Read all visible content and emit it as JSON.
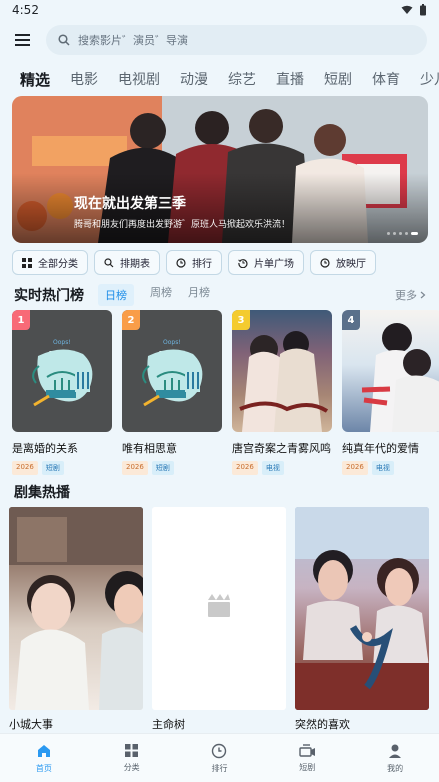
{
  "status": {
    "time": "4:52"
  },
  "search": {
    "placeholder": "搜索影片゛演员゛导演"
  },
  "tabs": [
    "精选",
    "电影",
    "电视剧",
    "动漫",
    "综艺",
    "直播",
    "短剧",
    "体育",
    "少儿"
  ],
  "banner": {
    "title": "现在就出发第三季",
    "subtitle": "腾哥和朋友们再度出发野游゛原班人马掀起欢乐洪流！"
  },
  "quick_actions": [
    {
      "label": "全部分类",
      "icon": "grid-icon"
    },
    {
      "label": "排期表",
      "icon": "search-icon"
    },
    {
      "label": "排行",
      "icon": "clock-icon"
    },
    {
      "label": "片单广场",
      "icon": "history-icon"
    },
    {
      "label": "放映厅",
      "icon": "clock-icon"
    }
  ],
  "rankings": {
    "title": "实时热门榜",
    "tabs": [
      "日榜",
      "周榜",
      "月榜"
    ],
    "more": "更多",
    "items": [
      {
        "rank": "1",
        "title": "是离婚的关系",
        "year": "2026",
        "kind": "短剧"
      },
      {
        "rank": "2",
        "title": "唯有相思意",
        "year": "2026",
        "kind": "短剧"
      },
      {
        "rank": "3",
        "title": "唐宫奇案之青雾风鸣",
        "year": "2026",
        "kind": "电视"
      },
      {
        "rank": "4",
        "title": "纯真年代的爱情",
        "year": "2026",
        "kind": "电视"
      }
    ]
  },
  "drama_hot": {
    "title": "剧集热播",
    "items": [
      {
        "title": "小城大事"
      },
      {
        "title": "主命树"
      },
      {
        "title": "突然的喜欢"
      }
    ]
  },
  "placeholder_logo": {
    "brand": "Oops!",
    "code": "404"
  },
  "bottom_nav": [
    {
      "label": "首页",
      "icon": "home-icon",
      "active": true
    },
    {
      "label": "分类",
      "icon": "category-icon",
      "active": false
    },
    {
      "label": "排行",
      "icon": "ranking-icon",
      "active": false
    },
    {
      "label": "短剧",
      "icon": "short-drama-icon",
      "active": false
    },
    {
      "label": "我的",
      "icon": "profile-icon",
      "active": false
    }
  ],
  "colors": {
    "accent": "#2a99f1",
    "background": "#eef6fb",
    "rank_1": "#f86a77",
    "rank_2": "#f99d48",
    "rank_3": "#f4cb2f",
    "rank_4": "#5a708b"
  }
}
